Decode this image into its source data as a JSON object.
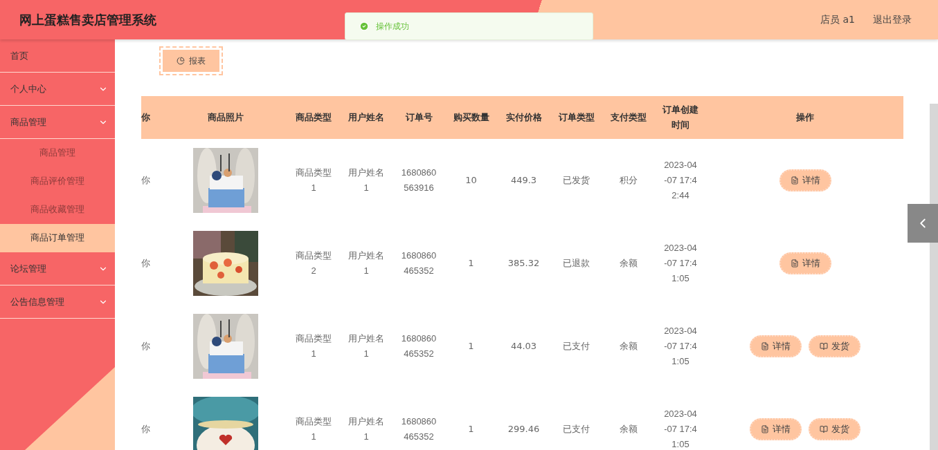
{
  "header": {
    "title": "网上蛋糕售卖店管理系统",
    "user": "店员 a1",
    "logout": "退出登录"
  },
  "toast": {
    "message": "操作成功"
  },
  "sidebar": {
    "items": [
      {
        "label": "首页",
        "kind": "link",
        "selected": false
      },
      {
        "label": "个人中心",
        "kind": "group",
        "selected": false
      },
      {
        "label": "商品管理",
        "kind": "group",
        "selected": false,
        "children": [
          {
            "label": "商品管理",
            "selected": false
          },
          {
            "label": "商品评价管理",
            "selected": false
          },
          {
            "label": "商品收藏管理",
            "selected": false
          },
          {
            "label": "商品订单管理",
            "selected": true
          }
        ]
      },
      {
        "label": "论坛管理",
        "kind": "group",
        "selected": false
      },
      {
        "label": "公告信息管理",
        "kind": "group",
        "selected": false
      }
    ]
  },
  "toolbar": {
    "report_button": "报表"
  },
  "table": {
    "columns": [
      "你",
      "商品照片",
      "商品类型",
      "用户姓名",
      "订单号",
      "购买数量",
      "实付价格",
      "订单类型",
      "支付类型",
      "订单创建时间",
      "操作"
    ],
    "rows": [
      {
        "column_1": "你",
        "photo": {
          "kind": "picture"
        },
        "type": "商品类型1",
        "user": "用户姓名1",
        "order_no": "1680860563916",
        "qty": "10",
        "price": "449.3",
        "order_type": "已发货",
        "pay_type": "积分",
        "created": "2023-04-07 17:42:44",
        "actions": [
          {
            "label": "详情",
            "kind": "detail"
          }
        ]
      },
      {
        "column_1": "你",
        "photo": {
          "kind": "picture"
        },
        "type": "商品类型2",
        "user": "用户姓名1",
        "order_no": "1680860465352",
        "qty": "1",
        "price": "385.32",
        "order_type": "已退款",
        "pay_type": "余额",
        "created": "2023-04-07 17:41:05",
        "actions": [
          {
            "label": "详情",
            "kind": "detail"
          }
        ]
      },
      {
        "column_1": "你",
        "photo": {
          "kind": "picture"
        },
        "type": "商品类型1",
        "user": "用户姓名1",
        "order_no": "1680860465352",
        "qty": "1",
        "price": "44.03",
        "order_type": "已支付",
        "pay_type": "余额",
        "created": "2023-04-07 17:41:05",
        "actions": [
          {
            "label": "详情",
            "kind": "detail"
          },
          {
            "label": "发货",
            "kind": "ship"
          }
        ]
      },
      {
        "column_1": "你",
        "photo": {
          "kind": "picture"
        },
        "type": "商品类型1",
        "user": "用户姓名1",
        "order_no": "1680860465352",
        "qty": "1",
        "price": "299.46",
        "order_type": "已支付",
        "pay_type": "余额",
        "created": "2023-04-07 17:41:05",
        "actions": [
          {
            "label": "详情",
            "kind": "detail"
          },
          {
            "label": "发货",
            "kind": "ship"
          }
        ]
      }
    ]
  }
}
